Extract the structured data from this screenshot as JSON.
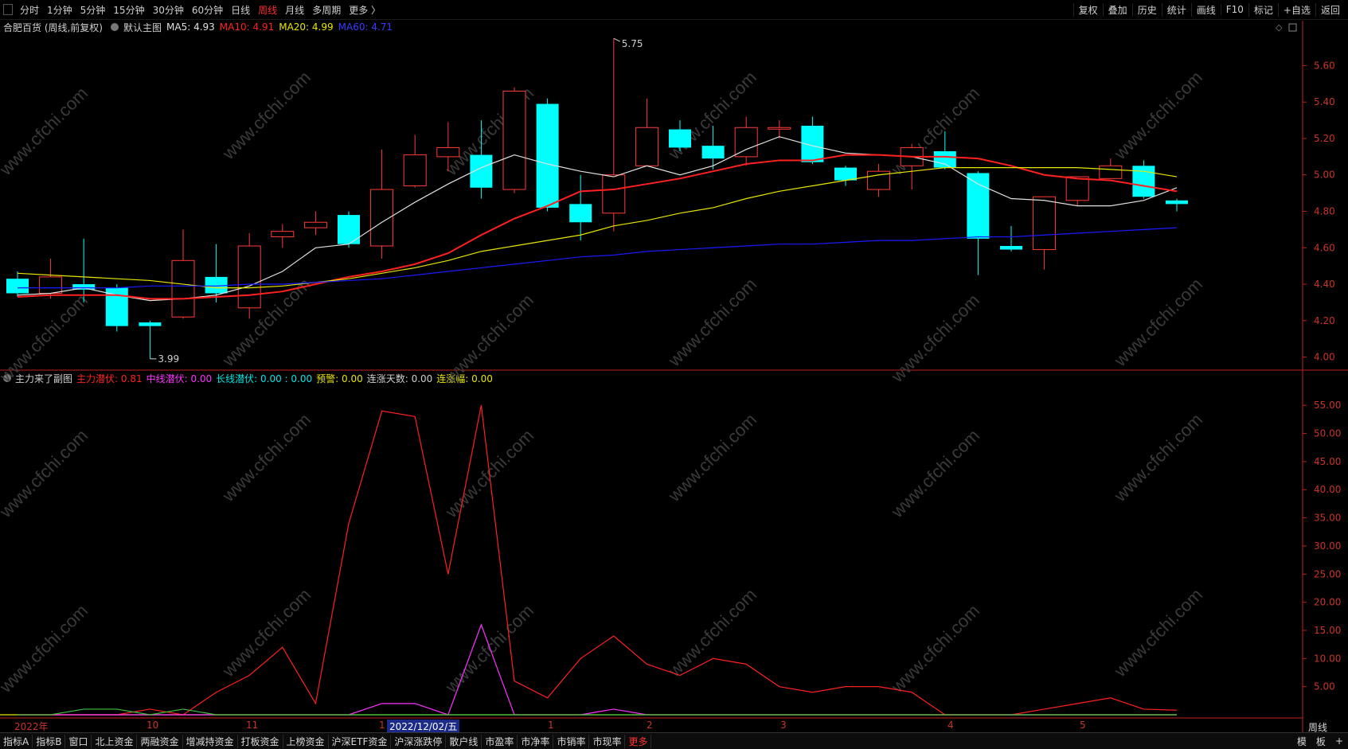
{
  "toolbar": {
    "periods": [
      "分时",
      "1分钟",
      "5分钟",
      "15分钟",
      "30分钟",
      "60分钟",
      "日线",
      "周线",
      "月线",
      "多周期",
      "更多 〉"
    ],
    "active_period": "周线",
    "right_buttons": [
      "复权",
      "叠加",
      "历史",
      "统计",
      "画线",
      "F10",
      "标记",
      "+自选",
      "返回"
    ]
  },
  "main_chart": {
    "stock_title": "合肥百货 (周线,前复权)",
    "indicator_name": "默认主图",
    "ma5": "MA5: 4.93",
    "ma10": "MA10: 4.91",
    "ma20": "MA20: 4.99",
    "ma60": "MA60: 4.71",
    "high_marker": "5.75",
    "low_marker": "3.99",
    "y_ticks": [
      "5.60",
      "5.40",
      "5.20",
      "5.00",
      "4.80",
      "4.60",
      "4.40",
      "4.20",
      "4.00"
    ]
  },
  "sub_chart": {
    "title": "主力来了副图",
    "l1": "主力潜伏: 0.81",
    "l2": "中线潜伏: 0.00",
    "l3": "长线潜伏: 0.00 : 0.00",
    "l4": "预警: 0.00",
    "l5": "连涨天数: 0.00",
    "l6": "连涨幅: 0.00",
    "y_ticks": [
      "55.00",
      "50.00",
      "45.00",
      "40.00",
      "35.00",
      "30.00",
      "25.00",
      "20.00",
      "15.00",
      "10.00",
      "5.00"
    ]
  },
  "date_axis": {
    "labels": [
      "2022年",
      "10",
      "11",
      "1",
      "2022/12/02/五",
      "1",
      "2",
      "3",
      "4",
      "5"
    ],
    "cursor_label": "2022/12/02/五",
    "period_label": "周线"
  },
  "watermark": "www.cfchi.com",
  "bottom_tabs": [
    "指标A",
    "指标B",
    "窗口",
    "北上资金",
    "两融资金",
    "增减持资金",
    "打板资金",
    "上榜资金",
    "沪深ETF资金",
    "沪深涨跌停",
    "散户线",
    "市盈率",
    "市净率",
    "市销率",
    "市现率",
    "更多"
  ],
  "bottom_right": [
    "模",
    "板",
    "+"
  ],
  "colors": {
    "up": "#ff3a3a",
    "down": "#00ffff",
    "ma5": "#e0e0e0",
    "ma10": "#ff2020",
    "ma20": "#e6e600",
    "ma60": "#1a1aff"
  },
  "chart_data": [
    {
      "type": "candlestick",
      "title": "合肥百货 (周线,前复权)",
      "ylim": [
        3.95,
        5.72
      ],
      "series": [
        {
          "name": "K线",
          "ohlc": [
            [
              4.43,
              4.35,
              4.47,
              4.33
            ],
            [
              4.35,
              4.44,
              4.54,
              4.32
            ],
            [
              4.4,
              4.37,
              4.65,
              4.3
            ],
            [
              4.38,
              4.17,
              4.4,
              4.14
            ],
            [
              4.19,
              4.17,
              4.2,
              3.99
            ],
            [
              4.22,
              4.53,
              4.7,
              4.21
            ],
            [
              4.44,
              4.35,
              4.62,
              4.3
            ],
            [
              4.27,
              4.61,
              4.68,
              4.21
            ],
            [
              4.66,
              4.69,
              4.73,
              4.6
            ],
            [
              4.71,
              4.74,
              4.8,
              4.67
            ],
            [
              4.78,
              4.62,
              4.8,
              4.6
            ],
            [
              4.61,
              4.92,
              5.14,
              4.54
            ],
            [
              4.94,
              5.11,
              5.22,
              4.93
            ],
            [
              5.1,
              5.15,
              5.29,
              5.02
            ],
            [
              5.11,
              4.93,
              5.3,
              4.87
            ],
            [
              4.92,
              5.46,
              5.48,
              4.9
            ],
            [
              5.39,
              4.82,
              5.42,
              4.8
            ],
            [
              4.84,
              4.74,
              5.0,
              4.64
            ],
            [
              4.79,
              5.0,
              5.75,
              4.69
            ],
            [
              5.05,
              5.26,
              5.42,
              5.05
            ],
            [
              5.25,
              5.15,
              5.3,
              5.13
            ],
            [
              5.16,
              5.09,
              5.27,
              5.03
            ],
            [
              5.1,
              5.26,
              5.32,
              5.05
            ],
            [
              5.26,
              5.26,
              5.3,
              5.2
            ],
            [
              5.27,
              5.07,
              5.32,
              5.06
            ],
            [
              5.04,
              4.97,
              5.05,
              4.94
            ],
            [
              4.92,
              5.02,
              5.06,
              4.88
            ],
            [
              5.05,
              5.15,
              5.17,
              4.92
            ],
            [
              5.13,
              5.04,
              5.24,
              5.03
            ],
            [
              5.01,
              4.65,
              5.02,
              4.45
            ],
            [
              4.61,
              4.59,
              4.72,
              4.58
            ],
            [
              4.59,
              4.88,
              4.88,
              4.48
            ],
            [
              4.86,
              4.99,
              4.99,
              4.83
            ],
            [
              4.98,
              5.05,
              5.09,
              4.98
            ],
            [
              5.05,
              4.88,
              5.08,
              4.87
            ],
            [
              4.86,
              4.84,
              4.87,
              4.8
            ]
          ]
        },
        {
          "name": "MA5",
          "values": [
            4.34,
            4.35,
            4.38,
            4.34,
            4.31,
            4.32,
            4.34,
            4.39,
            4.47,
            4.6,
            4.62,
            4.74,
            4.85,
            4.95,
            5.04,
            5.11,
            5.06,
            5.02,
            4.99,
            5.05,
            5.0,
            5.05,
            5.14,
            5.21,
            5.16,
            5.12,
            5.11,
            5.1,
            5.06,
            4.95,
            4.87,
            4.86,
            4.83,
            4.83,
            4.86,
            4.93
          ]
        },
        {
          "name": "MA10",
          "values": [
            4.33,
            4.34,
            4.34,
            4.34,
            4.32,
            4.32,
            4.33,
            4.34,
            4.36,
            4.4,
            4.44,
            4.47,
            4.51,
            4.57,
            4.67,
            4.76,
            4.83,
            4.91,
            4.92,
            4.95,
            4.98,
            5.02,
            5.06,
            5.08,
            5.08,
            5.11,
            5.11,
            5.1,
            5.1,
            5.09,
            5.05,
            5.0,
            4.98,
            4.97,
            4.94,
            4.91
          ]
        },
        {
          "name": "MA20",
          "values": [
            4.46,
            4.45,
            4.44,
            4.43,
            4.42,
            4.4,
            4.38,
            4.38,
            4.39,
            4.41,
            4.43,
            4.46,
            4.49,
            4.53,
            4.58,
            4.61,
            4.64,
            4.67,
            4.72,
            4.75,
            4.79,
            4.82,
            4.87,
            4.91,
            4.94,
            4.97,
            5.0,
            5.02,
            5.04,
            5.04,
            5.04,
            5.04,
            5.04,
            5.03,
            5.02,
            4.99
          ]
        },
        {
          "name": "MA60",
          "values": [
            4.38,
            4.38,
            4.38,
            4.38,
            4.39,
            4.39,
            4.39,
            4.4,
            4.4,
            4.41,
            4.42,
            4.43,
            4.45,
            4.47,
            4.49,
            4.51,
            4.53,
            4.55,
            4.56,
            4.58,
            4.59,
            4.6,
            4.61,
            4.62,
            4.62,
            4.63,
            4.64,
            4.64,
            4.65,
            4.66,
            4.66,
            4.67,
            4.68,
            4.69,
            4.7,
            4.71
          ]
        }
      ]
    },
    {
      "type": "line",
      "title": "主力来了副图",
      "ylim": [
        0,
        58
      ],
      "series": [
        {
          "name": "主力潜伏",
          "values": [
            0,
            0,
            0,
            0,
            1,
            0,
            4,
            7,
            12,
            2,
            34,
            54,
            53,
            25,
            55,
            6,
            3,
            10,
            14,
            9,
            7,
            10,
            9,
            5,
            4,
            5,
            5,
            4,
            0,
            0,
            0,
            1,
            2,
            3,
            1,
            0.81
          ]
        },
        {
          "name": "中线潜伏",
          "values": [
            0,
            0,
            0,
            0,
            0,
            0,
            0,
            0,
            0,
            0,
            0,
            2,
            2,
            0,
            16,
            0,
            0,
            0,
            1,
            0,
            0,
            0,
            0,
            0,
            0,
            0,
            0,
            0,
            0,
            0,
            0,
            0,
            0,
            0,
            0,
            0
          ]
        },
        {
          "name": "长线潜伏",
          "values": [
            0,
            0,
            1,
            1,
            0,
            1,
            0,
            0,
            0,
            0,
            0,
            0,
            0,
            0,
            0,
            0,
            0,
            0,
            0,
            0,
            0,
            0,
            0,
            0,
            0,
            0,
            0,
            0,
            0,
            0,
            0,
            0,
            0,
            0,
            0,
            0
          ]
        }
      ]
    }
  ]
}
